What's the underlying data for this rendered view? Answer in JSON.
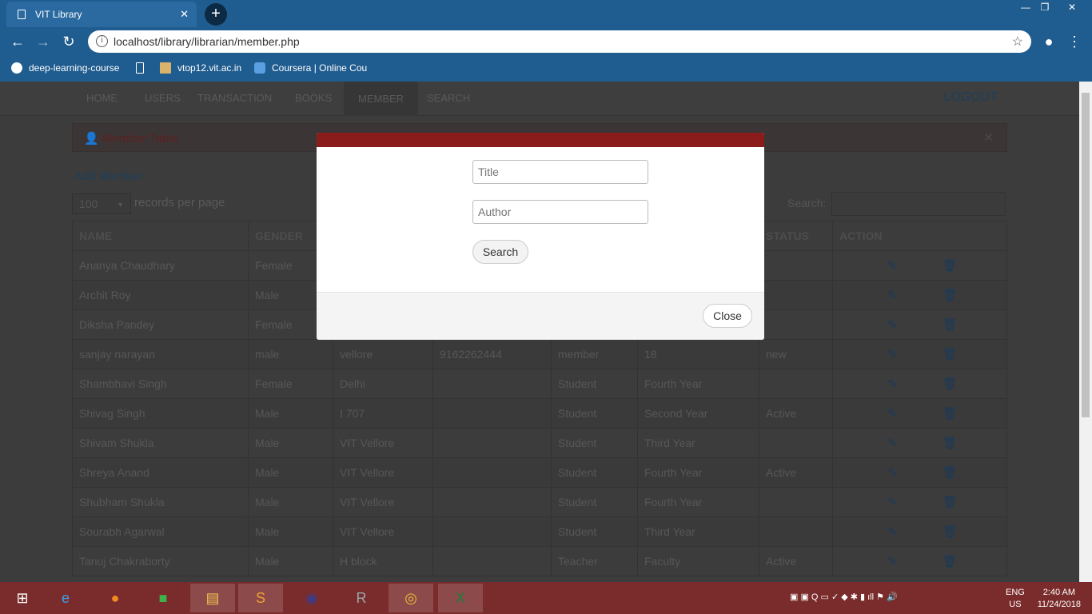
{
  "browser": {
    "tab_title": "VIT Library",
    "url": "localhost/library/librarian/member.php",
    "bookmarks": [
      "deep-learning-course",
      "vtop12.vit.ac.in",
      "Coursera | Online Cou"
    ]
  },
  "nav": {
    "items": [
      "HOME",
      "USERS",
      "TRANSACTION",
      "BOOKS",
      "MEMBER",
      "SEARCH"
    ],
    "active": "MEMBER",
    "logout": "LOGOUT"
  },
  "panel": {
    "title": "Member Table",
    "add_member": "Add Member",
    "records_value": "100",
    "records_label": "records per page",
    "search_label": "Search:"
  },
  "table": {
    "headers": [
      "NAME",
      "GENDER",
      "",
      "",
      "",
      "",
      "STATUS",
      "ACTION"
    ],
    "rows": [
      [
        "Ananya Chaudhary",
        "Female",
        "",
        "",
        "",
        "",
        ""
      ],
      [
        "Archit Roy",
        "Male",
        "",
        "",
        "",
        "",
        ""
      ],
      [
        "Diksha Pandey",
        "Female",
        "",
        "",
        "",
        "",
        ""
      ],
      [
        "sanjay narayan",
        "male",
        "vellore",
        "9162262444",
        "member",
        "18",
        "new"
      ],
      [
        "Shambhavi Singh",
        "Female",
        "Delhi",
        "",
        "Student",
        "Fourth Year",
        ""
      ],
      [
        "Shivag Singh",
        "Male",
        "I 707",
        "",
        "Student",
        "Second Year",
        "Active"
      ],
      [
        "Shivam Shukla",
        "Male",
        "VIT Vellore",
        "",
        "Student",
        "Third Year",
        ""
      ],
      [
        "Shreya Anand",
        "Male",
        "VIT Vellore",
        "",
        "Student",
        "Fourth Year",
        "Active"
      ],
      [
        "Shubham Shukla",
        "Male",
        "VIT Vellore",
        "",
        "Student",
        "Fourth Year",
        ""
      ],
      [
        "Sourabh Agarwal",
        "Male",
        "VIT Vellore",
        "",
        "Student",
        "Third Year",
        ""
      ],
      [
        "Tanuj Chakraborty",
        "Male",
        "H block",
        "",
        "Teacher",
        "Faculty",
        "Active"
      ]
    ]
  },
  "modal": {
    "title_placeholder": "Title",
    "author_placeholder": "Author",
    "search_button": "Search",
    "close_button": "Close"
  },
  "taskbar": {
    "lang": "ENG",
    "region": "US",
    "time": "2:40 AM",
    "date": "11/24/2018"
  },
  "colors": {
    "modal_header": "#8b1c1c",
    "taskbar": "#7a2b2b",
    "browser": "#1f5c8f"
  }
}
